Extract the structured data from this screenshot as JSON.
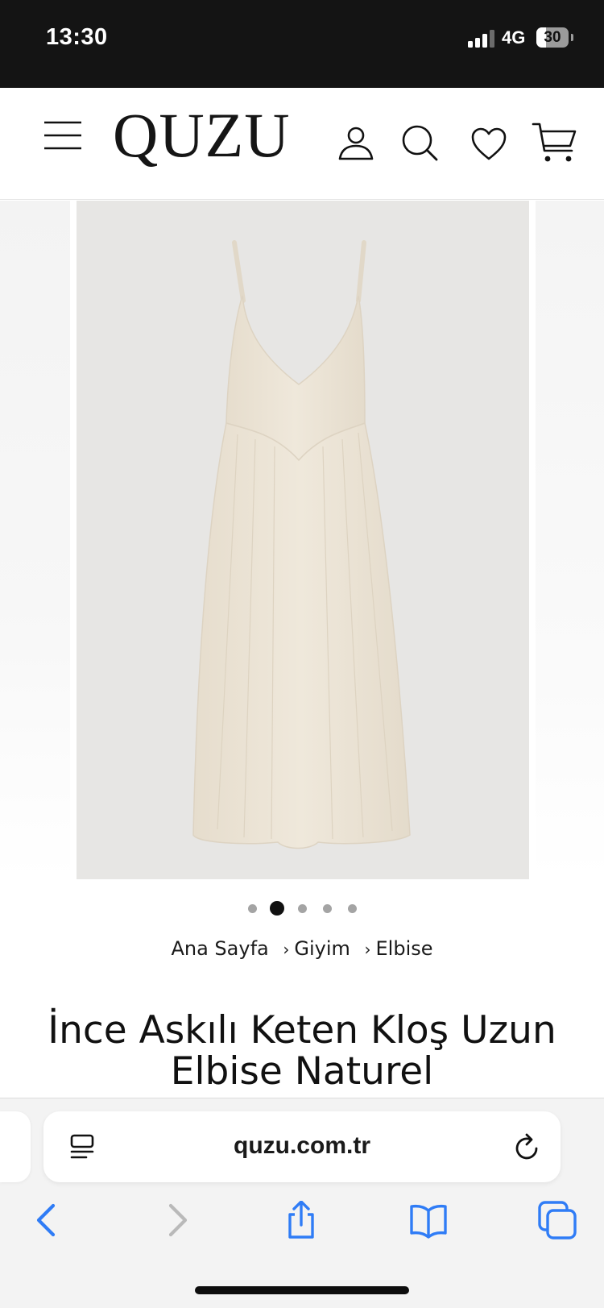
{
  "status_bar": {
    "time": "13:30",
    "network": "4G",
    "battery_percent": 30,
    "battery_label": "30",
    "signal_bars_active": 3,
    "signal_bars_total": 4
  },
  "header": {
    "logo": "QUZU",
    "icons": [
      "menu-icon",
      "account-icon",
      "search-icon",
      "wishlist-heart-icon",
      "cart-icon"
    ]
  },
  "gallery": {
    "slide_count": 5,
    "active_index": 1,
    "background_color": "#e7e6e4",
    "dress_color": "#ece4d6",
    "zoom_icon": "zoom-in-icon"
  },
  "breadcrumb": {
    "items": [
      "Ana Sayfa",
      "Giyim",
      "Elbise"
    ],
    "separator": "›"
  },
  "product": {
    "title_line1": "İnce Askılı Keten Kloş Uzun",
    "title_line2": "Elbise Naturel"
  },
  "browser": {
    "url": "quzu.com.tr",
    "accent_color": "#2f7cf6",
    "toolbar_icons": [
      "back-icon",
      "forward-icon",
      "share-icon",
      "bookmarks-icon",
      "tabs-icon"
    ]
  }
}
